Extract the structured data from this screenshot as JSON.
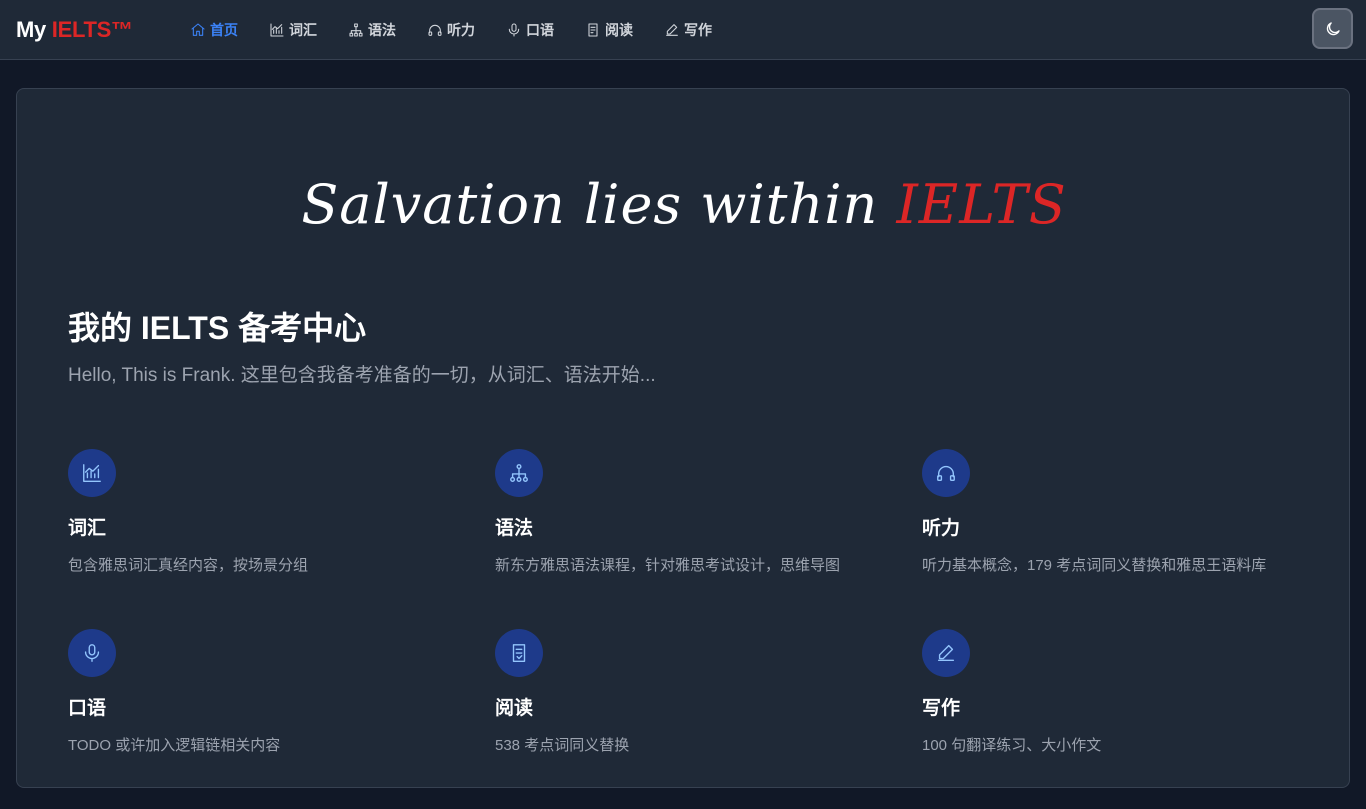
{
  "brand": {
    "part1": "My ",
    "part2": "IELTS™",
    "accent_color": "#dc2626"
  },
  "nav": {
    "items": [
      {
        "label": "首页",
        "icon": "home-icon",
        "active": true
      },
      {
        "label": "词汇",
        "icon": "chart-icon",
        "active": false
      },
      {
        "label": "语法",
        "icon": "sitemap-icon",
        "active": false
      },
      {
        "label": "听力",
        "icon": "headphones-icon",
        "active": false
      },
      {
        "label": "口语",
        "icon": "microphone-icon",
        "active": false
      },
      {
        "label": "阅读",
        "icon": "document-icon",
        "active": false
      },
      {
        "label": "写作",
        "icon": "pencil-icon",
        "active": false
      }
    ],
    "theme_toggle_icon": "moon-icon"
  },
  "hero": {
    "text": "Salvation lies within ",
    "accent": "IELTS"
  },
  "main": {
    "title": "我的 IELTS 备考中心",
    "subtitle": "Hello, This is Frank. 这里包含我备考准备的一切，从词汇、语法开始..."
  },
  "features": [
    {
      "title": "词汇",
      "desc": "包含雅思词汇真经内容，按场景分组",
      "icon": "chart-icon"
    },
    {
      "title": "语法",
      "desc": "新东方雅思语法课程，针对雅思考试设计，思维导图",
      "icon": "sitemap-icon"
    },
    {
      "title": "听力",
      "desc": "听力基本概念，179 考点词同义替换和雅思王语料库",
      "icon": "headphones-icon"
    },
    {
      "title": "口语",
      "desc": "TODO 或许加入逻辑链相关内容",
      "icon": "microphone-icon"
    },
    {
      "title": "阅读",
      "desc": "538 考点词同义替换",
      "icon": "document-icon"
    },
    {
      "title": "写作",
      "desc": "100 句翻译练习、大小作文",
      "icon": "pencil-icon"
    }
  ],
  "colors": {
    "background": "#111827",
    "surface": "#1f2937",
    "active": "#3b82f6",
    "icon_bg": "#1e3a8a"
  }
}
